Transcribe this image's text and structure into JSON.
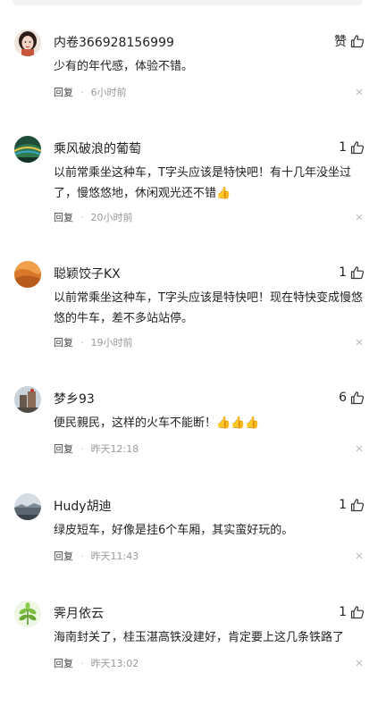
{
  "comments": [
    {
      "username": "内卷366928156999",
      "like_label": "赞",
      "text": "少有的年代感，体验不错。",
      "reply_label": "回复",
      "dot": "·",
      "time": "6小时前",
      "avatar_icon": "girl-portrait-icon"
    },
    {
      "username": "乘风破浪的葡萄",
      "like_label": "1",
      "text": "以前常乘坐这种车，T字头应该是特快吧！有十几年没坐过了，慢悠悠地，休闲观光还不错👍",
      "reply_label": "回复",
      "dot": "·",
      "time": "20小时前",
      "avatar_icon": "landscape-icon"
    },
    {
      "username": "聪颖饺子KX",
      "like_label": "1",
      "text": "以前常乘坐这种车，T字头应该是特快吧！现在特快变成慢悠悠的牛车，差不多站站停。",
      "reply_label": "回复",
      "dot": "·",
      "time": "19小时前",
      "avatar_icon": "desert-icon"
    },
    {
      "username": "梦乡93",
      "like_label": "6",
      "text": "便民親民，这样的火车不能断！👍👍👍",
      "reply_label": "回复",
      "dot": "·",
      "time": "昨天12:18",
      "avatar_icon": "building-photo-icon"
    },
    {
      "username": "Hudy胡迪",
      "like_label": "1",
      "text": "绿皮短车，好像是挂6个车厢，其实蛮好玩的。",
      "reply_label": "回复",
      "dot": "·",
      "time": "昨天11:43",
      "avatar_icon": "sky-photo-icon"
    },
    {
      "username": "霁月依云",
      "like_label": "1",
      "text": "海南封关了，桂玉湛高铁没建好，肯定要上这几条铁路了",
      "reply_label": "回复",
      "dot": "·",
      "time": "昨天13:02",
      "avatar_icon": "leaf-icon"
    }
  ],
  "colors": {
    "text": "#222222",
    "meta": "#999999",
    "top_bar": "#f3f3f3"
  }
}
